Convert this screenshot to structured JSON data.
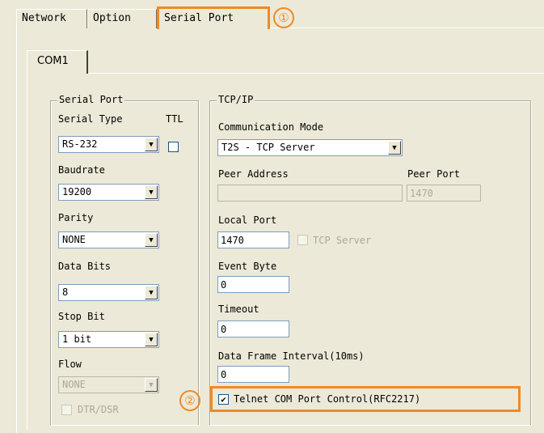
{
  "tabs": [
    {
      "label": "Network"
    },
    {
      "label": "Option"
    },
    {
      "label": "Serial Port"
    }
  ],
  "subtab": {
    "label": "COM1"
  },
  "callouts": {
    "one": "①",
    "two": "②"
  },
  "serial_group": {
    "title": "Serial Port",
    "serial_type_label": "Serial Type",
    "ttl_label": "TTL",
    "serial_type_value": "RS-232",
    "baudrate_label": "Baudrate",
    "baudrate_value": "19200",
    "parity_label": "Parity",
    "parity_value": "NONE",
    "data_bits_label": "Data Bits",
    "data_bits_value": "8",
    "stop_bit_label": "Stop Bit",
    "stop_bit_value": "1 bit",
    "flow_label": "Flow",
    "flow_value": "NONE",
    "dtr_dsr_label": "DTR/DSR"
  },
  "tcp_group": {
    "title": "TCP/IP",
    "comm_mode_label": "Communication Mode",
    "comm_mode_value": "T2S - TCP Server",
    "peer_address_label": "Peer Address",
    "peer_address_value": "",
    "peer_port_label": "Peer Port",
    "peer_port_value": "1470",
    "local_port_label": "Local Port",
    "local_port_value": "1470",
    "tcp_server_label": "TCP Server",
    "event_byte_label": "Event Byte",
    "event_byte_value": "0",
    "timeout_label": "Timeout",
    "timeout_value": "0",
    "data_frame_label": "Data Frame Interval(10ms)",
    "data_frame_value": "0",
    "telnet_label": "Telnet COM Port Control(RFC2217)",
    "telnet_checked": "✔"
  },
  "colors": {
    "accent": "#f08a24",
    "background": "#ece9d8",
    "input_border": "#7f9db9"
  }
}
